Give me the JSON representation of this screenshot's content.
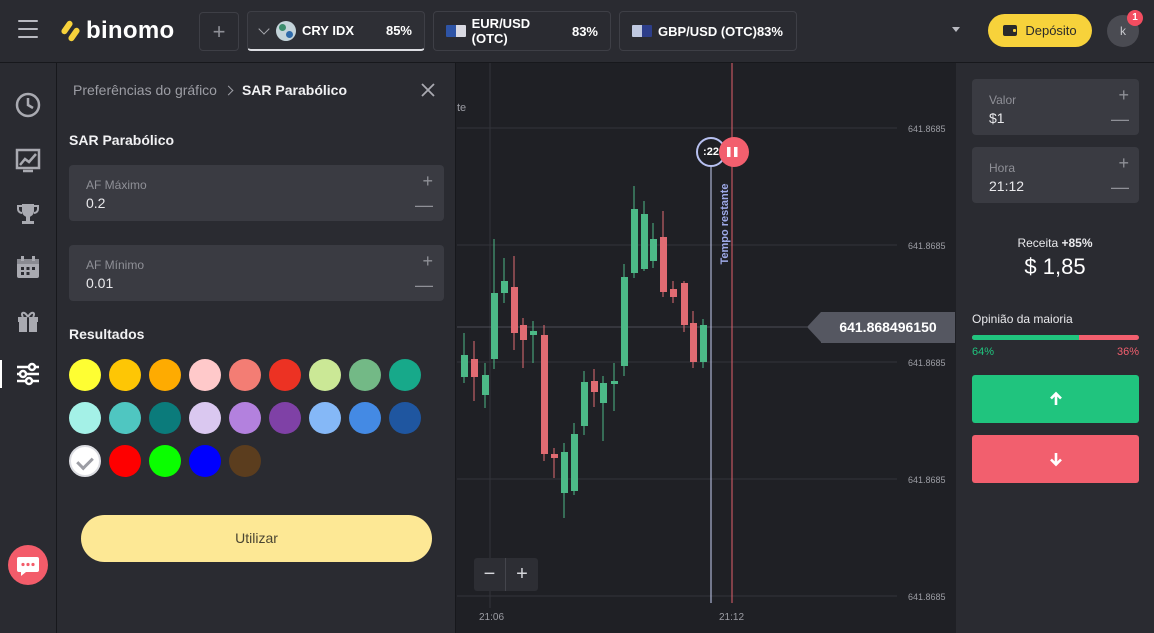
{
  "brand": {
    "name": "binomo"
  },
  "header": {
    "tabs": [
      {
        "name": "CRY IDX",
        "pct": "85%"
      },
      {
        "name": "EUR/USD (OTC)",
        "pct": "83%"
      },
      {
        "name": "GBP/USD (OTC)",
        "pct": "83%"
      }
    ],
    "deposit_label": "Depósito",
    "avatar_initial": "k",
    "notifications": "1"
  },
  "panel": {
    "breadcrumb_parent": "Preferências do gráfico",
    "breadcrumb_current": "SAR Parabólico",
    "title": "SAR Parabólico",
    "af_max": {
      "label": "AF Máximo",
      "value": "0.2"
    },
    "af_min": {
      "label": "AF Mínimo",
      "value": "0.01"
    },
    "results_title": "Resultados",
    "colors": [
      "#fefe33",
      "#fec605",
      "#feab01",
      "#ffc9ca",
      "#f37d74",
      "#ec3223",
      "#cbe896",
      "#73b986",
      "#17a98a",
      "#a4f1e7",
      "#4fc6c1",
      "#0b7b7b",
      "#dac8f0",
      "#b381de",
      "#7f41a6",
      "#85b8f7",
      "#448ae4",
      "#1f56a0",
      "#ffffff",
      "#fe0000",
      "#0afe00",
      "#0000fe",
      "#5b3d1e"
    ],
    "selected_color": "#ffffff",
    "apply_label": "Utilizar"
  },
  "chart": {
    "y_label": "641.8685",
    "current_price": "641.868496150",
    "x_labels": [
      "21:06",
      "21:12"
    ],
    "remaining_label": "Tempo restante",
    "timer_text": ":22",
    "up_color": "#4cb987",
    "down_color": "#e06b72"
  },
  "trade": {
    "amount": {
      "label": "Valor",
      "value": "$1"
    },
    "time": {
      "label": "Hora",
      "value": "21:12"
    },
    "revenue_label": "Receita",
    "revenue_pct": "+85%",
    "revenue_value": "$ 1,85",
    "majority_label": "Opinião da maioria",
    "majority_up": 64,
    "majority_up_text": "64%",
    "majority_down_text": "36%"
  }
}
